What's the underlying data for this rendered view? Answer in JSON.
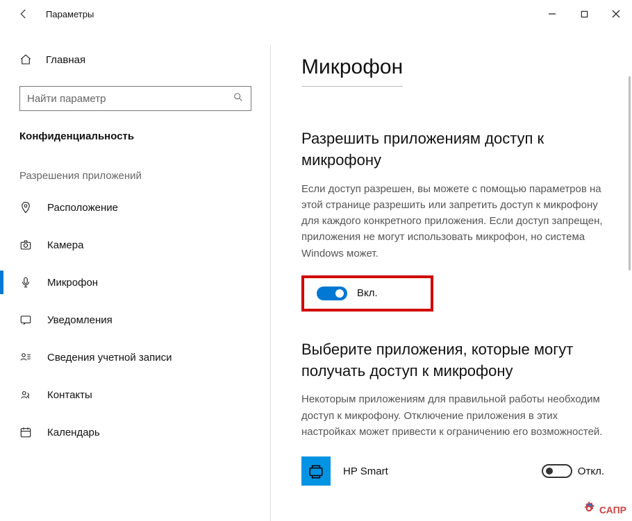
{
  "window": {
    "title": "Параметры"
  },
  "sidebar": {
    "home": "Главная",
    "search_placeholder": "Найти параметр",
    "section_header": "Конфиденциальность",
    "group_label": "Разрешения приложений",
    "items": [
      {
        "label": "Расположение"
      },
      {
        "label": "Камера"
      },
      {
        "label": "Микрофон"
      },
      {
        "label": "Уведомления"
      },
      {
        "label": "Сведения учетной записи"
      },
      {
        "label": "Контакты"
      },
      {
        "label": "Календарь"
      }
    ]
  },
  "content": {
    "page_title": "Микрофон",
    "sec1_title": "Разрешить приложениям доступ к микрофону",
    "sec1_text": "Если доступ разрешен, вы можете с помощью параметров на этой странице разрешить или запретить доступ к микрофону для каждого конкретного приложения. Если доступ запрещен, приложения не могут использовать микрофон, но система Windows может.",
    "toggle_on_label": "Вкл.",
    "sec2_title": "Выберите приложения, которые могут получать доступ к микрофону",
    "sec2_text": "Некоторым приложениям для правильной работы необходим доступ к микрофону. Отключение приложения в этих настройках может привести к ограничению его возможностей.",
    "app1_name": "HP Smart",
    "app1_toggle_label": "Откл.",
    "watermark": "САПР"
  }
}
